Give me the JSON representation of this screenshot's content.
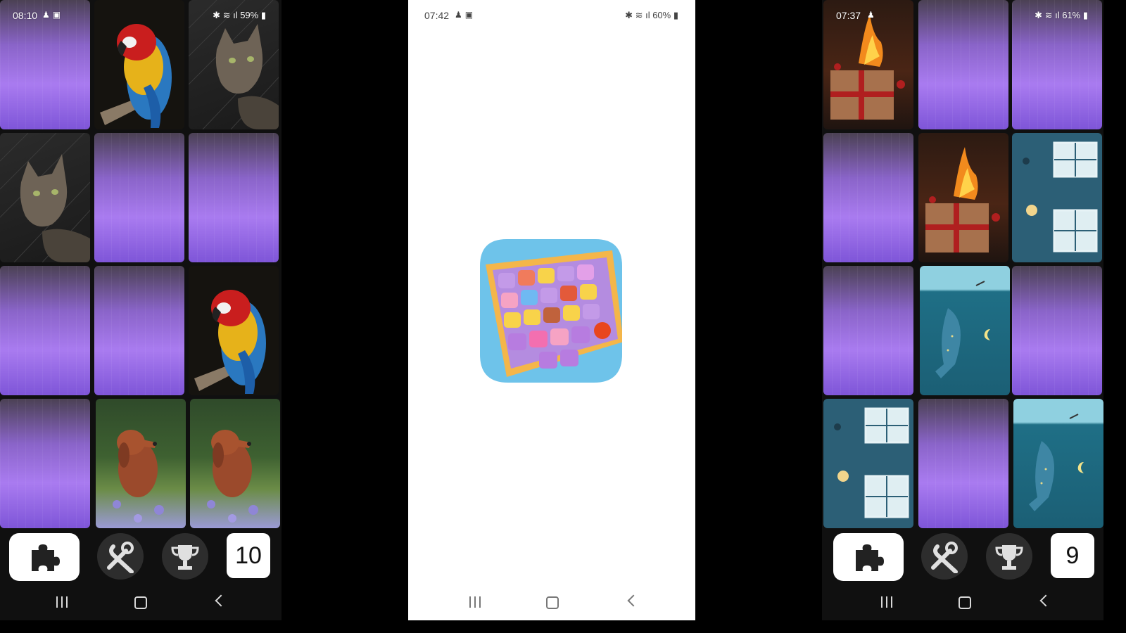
{
  "left_phone": {
    "status": {
      "time": "08:10",
      "battery": "59%"
    },
    "counter": "10",
    "tiles": [
      "card-back",
      "parrot",
      "cat",
      "cat",
      "card-back",
      "card-back",
      "card-back",
      "card-back",
      "parrot",
      "card-back",
      "dog",
      "dog"
    ]
  },
  "middle_phone": {
    "status": {
      "time": "07:42",
      "battery": "60%"
    },
    "app_icon": "match-puzzle-app-icon"
  },
  "right_phone": {
    "status": {
      "time": "07:37",
      "battery": "61%"
    },
    "counter": "9",
    "tiles": [
      "fireplace-gift",
      "card-back",
      "card-back",
      "card-back",
      "fireplace-gift",
      "snowy-window",
      "card-back",
      "whale",
      "card-back",
      "snowy-window",
      "card-back",
      "whale"
    ]
  },
  "colors": {
    "card_back_top": "#4b4154",
    "card_back_mid": "#a97bf0",
    "bar_bg": "#101010",
    "circle_btn": "#2d2d2d"
  },
  "icons": {
    "puzzle": "puzzle-piece-icon",
    "tools": "wrench-screwdriver-icon",
    "trophy": "trophy-icon",
    "nav_recent": "recent-apps-icon",
    "nav_home": "home-icon",
    "nav_back": "back-icon"
  }
}
